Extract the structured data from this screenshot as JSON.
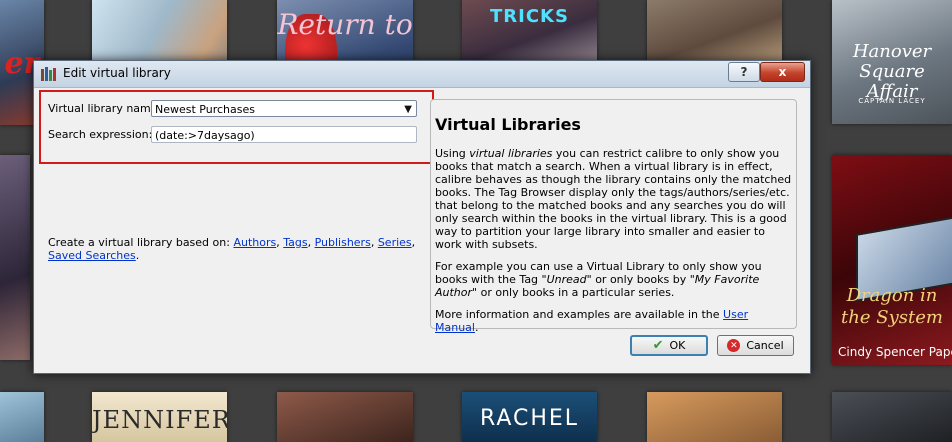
{
  "window": {
    "title": "Edit virtual library",
    "help_button": "?",
    "close_button": "x"
  },
  "form": {
    "name_label": "Virtual library name:",
    "name_value": "Newest Purchases",
    "search_label": "Search expression:",
    "search_value": "(date:>7daysago)"
  },
  "create": {
    "prefix": "Create a virtual library based on:",
    "links": [
      "Authors",
      "Tags",
      "Publishers",
      "Series",
      "Saved Searches"
    ]
  },
  "help": {
    "title": "Virtual Libraries",
    "p1_using": "Using",
    "p1_em": "virtual libraries",
    "p1_rest": "you can restrict calibre to only show you books that match a search. When a virtual library is in effect, calibre behaves as though the library contains only the matched books. The Tag Browser display only the tags/authors/series/etc. that belong to the matched books and any searches you do will only search within the books in the virtual library. This is a good way to partition your large library into smaller and easier to work with subsets.",
    "p2_a": "For example you can use a Virtual Library to only show you books with the Tag",
    "p2_tag": "\"Unread\"",
    "p2_b": "or only books by",
    "p2_author": "\"My Favorite Author\"",
    "p2_c": "or only books in a particular series.",
    "p3_a": "More information and examples are available in the",
    "p3_link": "User Manual",
    "p3_b": "."
  },
  "buttons": {
    "ok": "OK",
    "cancel": "Cancel"
  },
  "background_covers": {
    "c1": "er",
    "c3": "Return to",
    "c4": "TRICKS",
    "c6_title": "Hanover Square Affair",
    "c6_author": "CAPTAIN LACEY",
    "c8_title": "Dragon in the System",
    "c8_author": "Cindy Spencer Pape",
    "c10": "JENNIFER",
    "c12": "RACHEL"
  },
  "colors": {
    "highlight_box": "#d11a1a",
    "link": "#0033cc",
    "ok_icon": "#2f9c2f",
    "cancel_icon": "#d42a2a"
  }
}
